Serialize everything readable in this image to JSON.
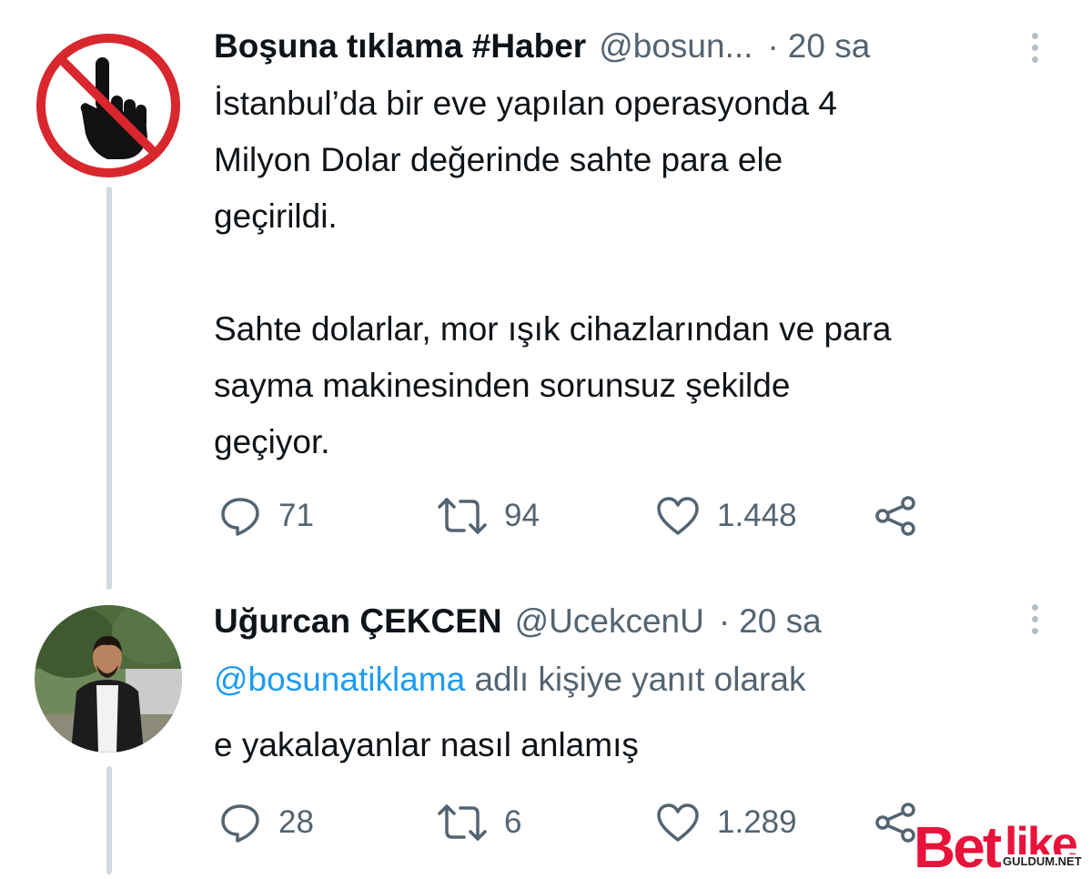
{
  "tweet1": {
    "display_name": "Boşuna tıklama #Haber",
    "handle": "@bosun...",
    "separator": "·",
    "time": "20 sa",
    "avatar_icon": "no-pointing-hand-icon",
    "text_paragraphs": [
      [
        "İstanbul’da bir eve yapılan operasyonda 4",
        "Milyon Dolar değerinde sahte para ele",
        "geçirildi."
      ],
      [
        "Sahte dolarlar, mor ışık cihazlarından ve para",
        "sayma makinesinden sorunsuz şekilde",
        "geçiyor."
      ]
    ],
    "replies": "71",
    "retweets": "94",
    "likes": "1.448"
  },
  "tweet2": {
    "display_name": "Uğurcan ÇEKCEN",
    "handle": "@UcekcenU",
    "separator": "·",
    "time": "20 sa",
    "reply_mention": "@bosunatiklama",
    "reply_suffix": "adlı kişiye yanıt olarak",
    "text": "e yakalayanlar nasıl anlamış",
    "replies": "28",
    "retweets": "6",
    "likes": "1.289"
  },
  "icons": {
    "reply": "reply-bubble-icon",
    "retweet": "retweet-icon",
    "like": "heart-icon",
    "share": "share-icon",
    "more": "more-vertical-icon"
  },
  "watermark": {
    "brand": "Betlike",
    "sub": "GULDUM.NET"
  },
  "colors": {
    "text": "#0f1419",
    "secondary": "#536471",
    "link": "#1d9bf0",
    "thread_line": "#cfd9de",
    "forbidden_red": "#d9272e"
  }
}
